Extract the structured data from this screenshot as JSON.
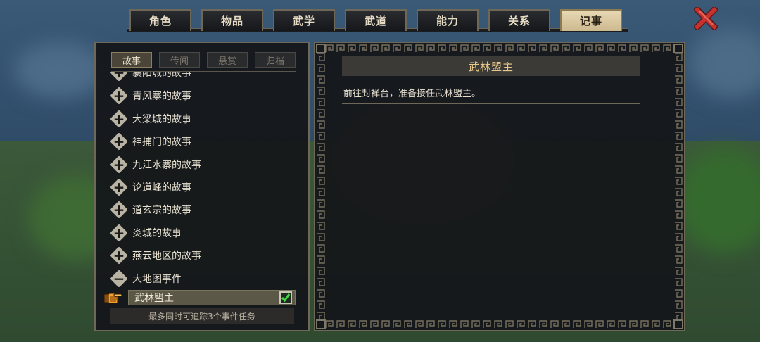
{
  "tabs": [
    {
      "label": "角色",
      "active": false
    },
    {
      "label": "物品",
      "active": false
    },
    {
      "label": "武学",
      "active": false
    },
    {
      "label": "武道",
      "active": false
    },
    {
      "label": "能力",
      "active": false
    },
    {
      "label": "关系",
      "active": false
    },
    {
      "label": "记事",
      "active": true
    }
  ],
  "subtabs": [
    {
      "label": "故事",
      "active": true
    },
    {
      "label": "传闻",
      "active": false
    },
    {
      "label": "悬赏",
      "active": false
    },
    {
      "label": "归档",
      "active": false
    }
  ],
  "story_list": [
    {
      "label": "襄阳城的故事",
      "icon": "plus-icon"
    },
    {
      "label": "青风寨的故事",
      "icon": "plus-icon"
    },
    {
      "label": "大梁城的故事",
      "icon": "plus-icon"
    },
    {
      "label": "神捕门的故事",
      "icon": "plus-icon"
    },
    {
      "label": "九江水寨的故事",
      "icon": "plus-icon"
    },
    {
      "label": "论道峰的故事",
      "icon": "plus-icon"
    },
    {
      "label": "道玄宗的故事",
      "icon": "plus-icon"
    },
    {
      "label": "炎城的故事",
      "icon": "plus-icon"
    },
    {
      "label": "燕云地区的故事",
      "icon": "plus-icon"
    },
    {
      "label": "大地图事件",
      "icon": "minus-icon"
    }
  ],
  "selected_event": {
    "label": "武林盟主",
    "tracked": true
  },
  "footer_note": "最多同时可追踪3个事件任务",
  "detail": {
    "title": "武林盟主",
    "description": "前往封禅台，准备接任武林盟主。"
  },
  "colors": {
    "accent": "#e8c88a",
    "panel_border": "#6e6858",
    "active_tab": "#e7d8b4",
    "close_red": "#c8322e"
  }
}
